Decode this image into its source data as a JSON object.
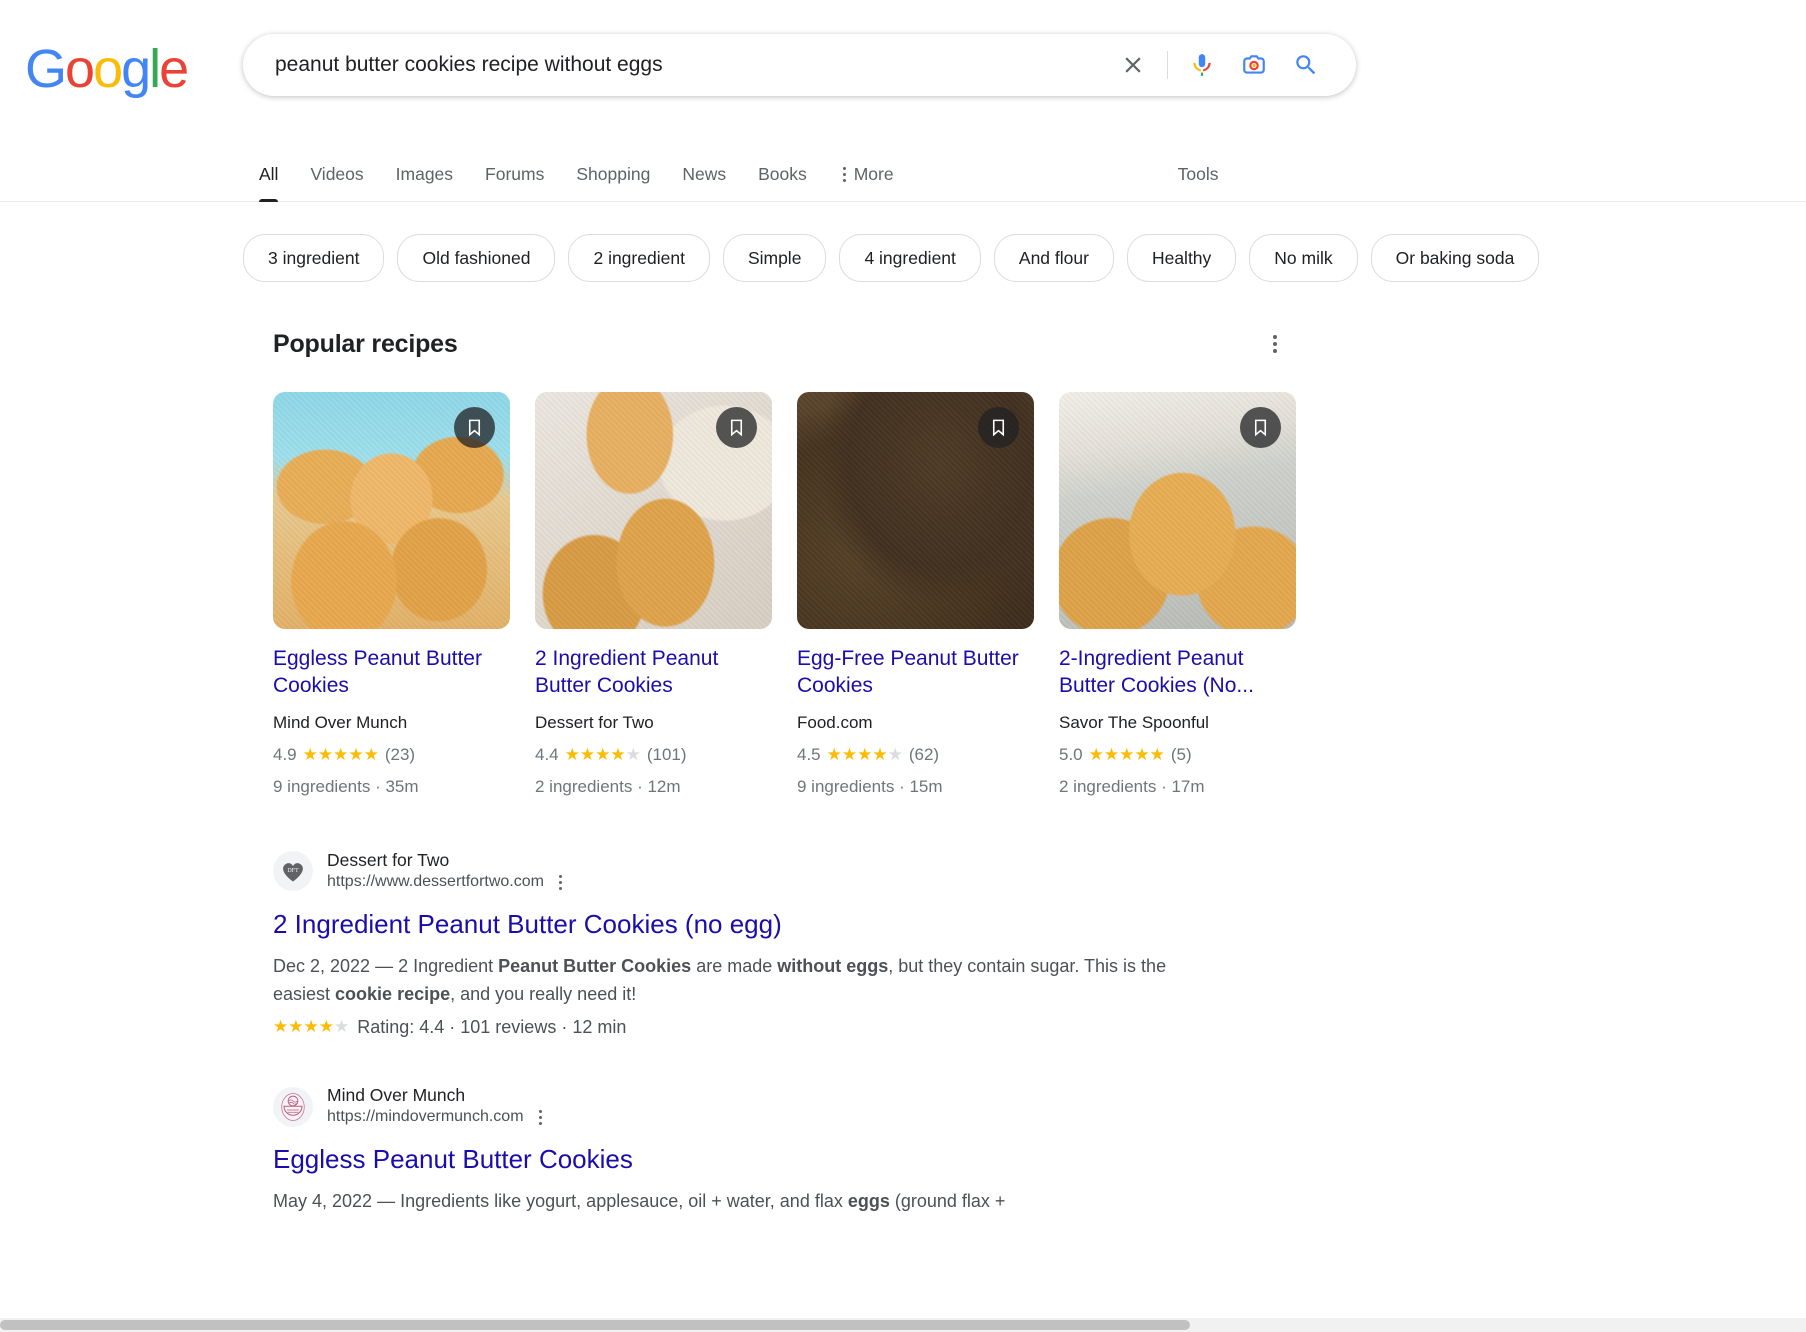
{
  "brand": {
    "name": "Google",
    "letters": [
      "G",
      "o",
      "o",
      "g",
      "l",
      "e"
    ]
  },
  "search": {
    "query": "peanut butter cookies recipe without eggs",
    "placeholder": "Search Google or type a URL",
    "clear_label": "Clear",
    "voice_label": "Search by voice",
    "lens_label": "Search by image",
    "submit_label": "Google Search"
  },
  "nav": {
    "tabs": [
      {
        "label": "All",
        "active": true
      },
      {
        "label": "Videos",
        "active": false
      },
      {
        "label": "Images",
        "active": false
      },
      {
        "label": "Forums",
        "active": false
      },
      {
        "label": "Shopping",
        "active": false
      },
      {
        "label": "News",
        "active": false
      },
      {
        "label": "Books",
        "active": false
      }
    ],
    "more_label": "More",
    "tools_label": "Tools"
  },
  "chips": [
    {
      "label": "3 ingredient"
    },
    {
      "label": "Old fashioned"
    },
    {
      "label": "2 ingredient"
    },
    {
      "label": "Simple"
    },
    {
      "label": "4 ingredient"
    },
    {
      "label": "And flour"
    },
    {
      "label": "Healthy"
    },
    {
      "label": "No milk"
    },
    {
      "label": "Or baking soda"
    }
  ],
  "popular_recipes": {
    "title": "Popular recipes",
    "menu_label": "About this result",
    "cards": [
      {
        "title": "Eggless Peanut Butter Cookies",
        "source": "Mind Over Munch",
        "rating_value": "4.9",
        "stars_full": 5,
        "stars_half": 0,
        "reviews": "(23)",
        "meta": "9 ingredients · 35m",
        "bookmark_label": "Save"
      },
      {
        "title": "2 Ingredient Peanut Butter Cookies",
        "source": "Dessert for Two",
        "rating_value": "4.4",
        "stars_full": 4,
        "stars_half": 1,
        "reviews": "(101)",
        "meta": "2 ingredients · 12m",
        "bookmark_label": "Save"
      },
      {
        "title": "Egg-Free Peanut Butter Cookies",
        "source": "Food.com",
        "rating_value": "4.5",
        "stars_full": 4,
        "stars_half": 1,
        "reviews": "(62)",
        "meta": "9 ingredients · 15m",
        "bookmark_label": "Save"
      },
      {
        "title": "2-Ingredient Peanut Butter Cookies (No...",
        "source": "Savor The Spoonful",
        "rating_value": "5.0",
        "stars_full": 5,
        "stars_half": 0,
        "reviews": "(5)",
        "meta": "2 ingredients · 17m",
        "bookmark_label": "Save"
      }
    ]
  },
  "results": [
    {
      "site_name": "Dessert for Two",
      "url": "https://www.dessertfortwo.com",
      "favicon_text": "DFT",
      "favicon_name": "dessert-for-two-favicon",
      "title": "2 Ingredient Peanut Butter Cookies (no egg)",
      "snippet_date": "Dec 2, 2022 — ",
      "snippet_parts": [
        {
          "text": "2 Ingredient ",
          "bold": false
        },
        {
          "text": "Peanut Butter Cookies",
          "bold": true
        },
        {
          "text": " are made ",
          "bold": false
        },
        {
          "text": "without eggs",
          "bold": true
        },
        {
          "text": ", but they contain sugar. This is the easiest ",
          "bold": false
        },
        {
          "text": "cookie recipe",
          "bold": true
        },
        {
          "text": ", and you really need it!",
          "bold": false
        }
      ],
      "rating_line": "Rating: 4.4 · 101 reviews · 12 min",
      "stars_full": 4,
      "stars_half": 1,
      "kebab_label": "About this result"
    },
    {
      "site_name": "Mind Over Munch",
      "url": "https://mindovermunch.com",
      "favicon_text": "",
      "favicon_name": "mind-over-munch-favicon",
      "title": "Eggless Peanut Butter Cookies",
      "snippet_date": "May 4, 2022 — ",
      "snippet_parts": [
        {
          "text": "Ingredients like yogurt, applesauce, oil + water, and flax ",
          "bold": false
        },
        {
          "text": "eggs",
          "bold": true
        },
        {
          "text": " (ground flax + ",
          "bold": false
        }
      ],
      "rating_line": "",
      "stars_full": 0,
      "stars_half": 0,
      "kebab_label": "About this result"
    }
  ],
  "colors": {
    "link": "#1a0dab",
    "star": "#fbbc04",
    "text": "#202124",
    "muted": "#70757a"
  }
}
